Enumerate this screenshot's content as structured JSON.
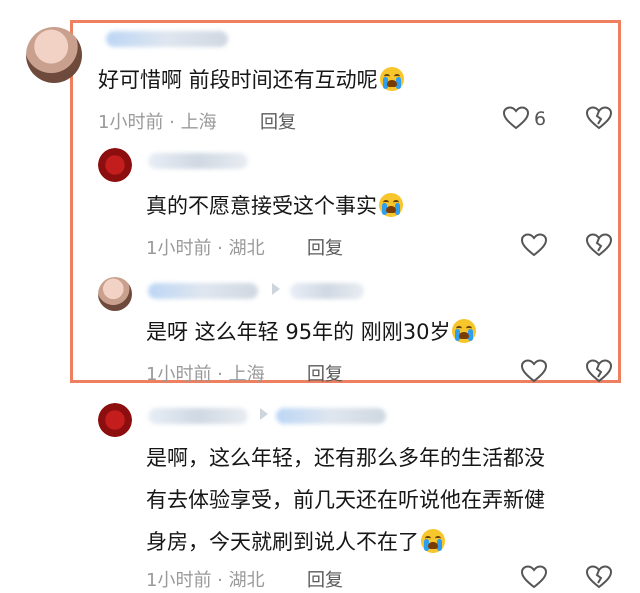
{
  "colors": {
    "highlight_border": "#ee7f5f",
    "meta_gray": "#9a9a9a",
    "text": "#161616"
  },
  "comments": [
    {
      "text": "好可惜啊 前段时间还有互动呢",
      "emoji": "crying-face",
      "time": "1小时前",
      "location": "上海",
      "reply_label": "回复",
      "like_count": "6"
    },
    {
      "text": "真的不愿意接受这个事实",
      "emoji": "crying-face",
      "time": "1小时前",
      "location": "湖北",
      "reply_label": "回复"
    },
    {
      "text": "是呀 这么年轻 95年的 刚刚30岁",
      "emoji": "crying-face",
      "time": "1小时前",
      "location": "上海",
      "reply_label": "回复"
    },
    {
      "text_lines": [
        "是啊，这么年轻，还有那么多年的生活都没",
        "有去体验享受，前几天还在听说他在弄新健",
        "身房，今天就刷到说人不在了"
      ],
      "emoji": "crying-face",
      "time": "1小时前",
      "location": "湖北",
      "reply_label": "回复"
    }
  ],
  "meta_separator": " · "
}
